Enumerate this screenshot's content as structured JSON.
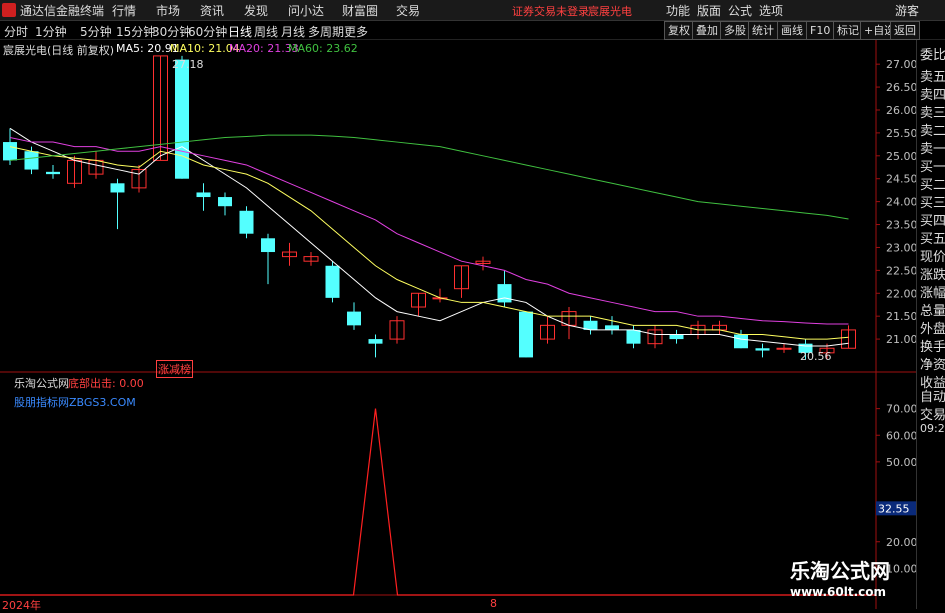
{
  "app": {
    "name": "通达信金融终端"
  },
  "menus": [
    "行情",
    "市场",
    "资讯",
    "发现",
    "问小达",
    "财富圈",
    "交易"
  ],
  "warning": "证券交易未登录",
  "stock_name_top": "宸展光电",
  "right_menus": [
    "功能",
    "版面",
    "公式",
    "选项"
  ],
  "guest": "游客",
  "periods": [
    "分时",
    "1分钟",
    "5分钟",
    "15分钟",
    "30分钟",
    "60分钟",
    "日线",
    "周线",
    "月线",
    "多周期",
    "更多"
  ],
  "active_period": "日线",
  "tool_buttons": [
    "复权",
    "叠加",
    "多股",
    "统计",
    "画线",
    "F10",
    "标记",
    "+自选",
    "返回"
  ],
  "main_header": {
    "title": "宸展光电(日线 前复权)",
    "ma5": "MA5: 20.91",
    "ma10": "MA10: 21.04",
    "ma20": "MA20: 21.33",
    "ma60": "MA60: 23.62"
  },
  "side_items": [
    "委比",
    "卖五",
    "卖四",
    "卖三",
    "卖二",
    "卖一",
    "买一",
    "买二",
    "买三",
    "买四",
    "买五",
    "现价",
    "涨跌",
    "涨幅",
    "总量",
    "外盘",
    "换手",
    "净资",
    "收益",
    "自动",
    "交易",
    "09:25"
  ],
  "indicator_header": {
    "name": "乐淘公式网",
    "signal_label": "底部出击: 0.00",
    "sub_label": "股朋指标网ZBGS3.COM"
  },
  "badge": "涨减榜",
  "high_label": "27.18",
  "low_label": "20.56",
  "date_left": "2024年",
  "date_mid": "8",
  "watermark": {
    "title": "乐淘公式网",
    "url": "www.60lt.com"
  },
  "colors": {
    "up": "#ff3030",
    "down": "#54ffff",
    "ma5": "#ffffff",
    "ma10": "#ffff60",
    "ma20": "#e040e0",
    "ma60": "#40c040",
    "signal": "#ff2020"
  },
  "chart_data": {
    "type": "candlestick",
    "price_axis": {
      "min": 20.5,
      "max": 27.2,
      "ticks": [
        "27.00",
        "26.50",
        "26.00",
        "25.50",
        "25.00",
        "24.50",
        "24.00",
        "23.50",
        "23.00",
        "22.50",
        "22.00",
        "21.50",
        "21.00"
      ]
    },
    "indicator_axis": {
      "ticks": [
        "70.00",
        "60.00",
        "50.00",
        "20.00",
        "10.00"
      ],
      "current": "32.55"
    },
    "candles": [
      {
        "o": 25.3,
        "c": 24.9,
        "h": 25.6,
        "l": 24.8
      },
      {
        "o": 25.1,
        "c": 24.7,
        "h": 25.2,
        "l": 24.6
      },
      {
        "o": 24.65,
        "c": 24.6,
        "h": 24.8,
        "l": 24.5
      },
      {
        "o": 24.4,
        "c": 24.9,
        "h": 25.0,
        "l": 24.3
      },
      {
        "o": 24.6,
        "c": 24.9,
        "h": 25.1,
        "l": 24.5
      },
      {
        "o": 24.4,
        "c": 24.2,
        "h": 24.5,
        "l": 23.4
      },
      {
        "o": 24.3,
        "c": 24.7,
        "h": 24.8,
        "l": 24.2
      },
      {
        "o": 24.9,
        "c": 27.18,
        "h": 27.18,
        "l": 24.9
      },
      {
        "o": 27.1,
        "c": 24.5,
        "h": 27.18,
        "l": 24.5
      },
      {
        "o": 24.2,
        "c": 24.1,
        "h": 24.4,
        "l": 23.8
      },
      {
        "o": 24.1,
        "c": 23.9,
        "h": 24.2,
        "l": 23.7
      },
      {
        "o": 23.8,
        "c": 23.3,
        "h": 23.9,
        "l": 23.2
      },
      {
        "o": 23.2,
        "c": 22.9,
        "h": 23.3,
        "l": 22.2
      },
      {
        "o": 22.8,
        "c": 22.9,
        "h": 23.1,
        "l": 22.6
      },
      {
        "o": 22.7,
        "c": 22.8,
        "h": 22.9,
        "l": 22.6
      },
      {
        "o": 22.6,
        "c": 21.9,
        "h": 22.7,
        "l": 21.8
      },
      {
        "o": 21.6,
        "c": 21.3,
        "h": 21.8,
        "l": 21.2
      },
      {
        "o": 21.0,
        "c": 20.9,
        "h": 21.1,
        "l": 20.6
      },
      {
        "o": 21.0,
        "c": 21.4,
        "h": 21.5,
        "l": 20.9
      },
      {
        "o": 21.7,
        "c": 22.0,
        "h": 22.0,
        "l": 21.5
      },
      {
        "o": 21.9,
        "c": 21.9,
        "h": 22.1,
        "l": 21.8
      },
      {
        "o": 22.1,
        "c": 22.6,
        "h": 22.6,
        "l": 21.9
      },
      {
        "o": 22.65,
        "c": 22.7,
        "h": 22.8,
        "l": 22.5
      },
      {
        "o": 22.2,
        "c": 21.8,
        "h": 22.5,
        "l": 21.7
      },
      {
        "o": 21.6,
        "c": 20.6,
        "h": 21.6,
        "l": 20.6
      },
      {
        "o": 21.0,
        "c": 21.3,
        "h": 21.5,
        "l": 20.9
      },
      {
        "o": 21.3,
        "c": 21.6,
        "h": 21.7,
        "l": 21.0
      },
      {
        "o": 21.4,
        "c": 21.2,
        "h": 21.5,
        "l": 21.1
      },
      {
        "o": 21.3,
        "c": 21.2,
        "h": 21.5,
        "l": 21.1
      },
      {
        "o": 21.2,
        "c": 20.9,
        "h": 21.3,
        "l": 20.8
      },
      {
        "o": 20.9,
        "c": 21.2,
        "h": 21.3,
        "l": 20.8
      },
      {
        "o": 21.1,
        "c": 21.0,
        "h": 21.2,
        "l": 20.9
      },
      {
        "o": 21.1,
        "c": 21.3,
        "h": 21.4,
        "l": 21.0
      },
      {
        "o": 21.2,
        "c": 21.3,
        "h": 21.4,
        "l": 21.1
      },
      {
        "o": 21.1,
        "c": 20.8,
        "h": 21.2,
        "l": 20.8
      },
      {
        "o": 20.8,
        "c": 20.75,
        "h": 20.9,
        "l": 20.6
      },
      {
        "o": 20.8,
        "c": 20.8,
        "h": 20.9,
        "l": 20.7
      },
      {
        "o": 20.9,
        "c": 20.7,
        "h": 21.0,
        "l": 20.56
      },
      {
        "o": 20.7,
        "c": 20.8,
        "h": 20.9,
        "l": 20.56
      },
      {
        "o": 20.8,
        "c": 21.2,
        "h": 21.3,
        "l": 20.8
      }
    ],
    "ma5": [
      25.6,
      25.3,
      25.1,
      24.9,
      24.8,
      24.7,
      24.6,
      25.0,
      25.2,
      24.9,
      24.6,
      24.3,
      23.9,
      23.5,
      23.1,
      22.7,
      22.3,
      21.9,
      21.6,
      21.5,
      21.4,
      21.6,
      21.8,
      21.9,
      21.8,
      21.5,
      21.3,
      21.2,
      21.2,
      21.2,
      21.1,
      21.1,
      21.1,
      21.1,
      21.0,
      20.95,
      20.9,
      20.85,
      20.85,
      20.91
    ],
    "ma10": [
      25.2,
      25.1,
      25.0,
      24.95,
      24.9,
      24.8,
      24.75,
      25.1,
      25.0,
      24.8,
      24.7,
      24.6,
      24.4,
      24.1,
      23.8,
      23.4,
      23.0,
      22.6,
      22.3,
      22.1,
      21.9,
      21.8,
      21.8,
      21.7,
      21.6,
      21.5,
      21.5,
      21.5,
      21.4,
      21.3,
      21.3,
      21.3,
      21.2,
      21.2,
      21.1,
      21.1,
      21.05,
      21.0,
      21.0,
      21.04
    ],
    "ma20": [
      25.4,
      25.3,
      25.3,
      25.2,
      25.2,
      25.1,
      25.1,
      25.2,
      25.1,
      25.0,
      24.9,
      24.8,
      24.6,
      24.4,
      24.2,
      24.0,
      23.8,
      23.6,
      23.3,
      23.1,
      22.9,
      22.7,
      22.6,
      22.5,
      22.3,
      22.2,
      22.0,
      21.9,
      21.8,
      21.7,
      21.6,
      21.6,
      21.5,
      21.5,
      21.45,
      21.4,
      21.38,
      21.35,
      21.33,
      21.33
    ],
    "ma60": [
      24.9,
      24.95,
      25.0,
      25.05,
      25.1,
      25.15,
      25.2,
      25.25,
      25.3,
      25.35,
      25.4,
      25.42,
      25.45,
      25.45,
      25.45,
      25.43,
      25.4,
      25.35,
      25.3,
      25.25,
      25.2,
      25.1,
      25.0,
      24.9,
      24.8,
      24.7,
      24.6,
      24.5,
      24.4,
      24.3,
      24.2,
      24.1,
      24.0,
      23.95,
      23.9,
      23.85,
      23.8,
      23.75,
      23.7,
      23.62
    ],
    "indicator": {
      "name": "底部出击",
      "peak_index": 17,
      "peak_value": 70,
      "base_value": 0
    }
  }
}
